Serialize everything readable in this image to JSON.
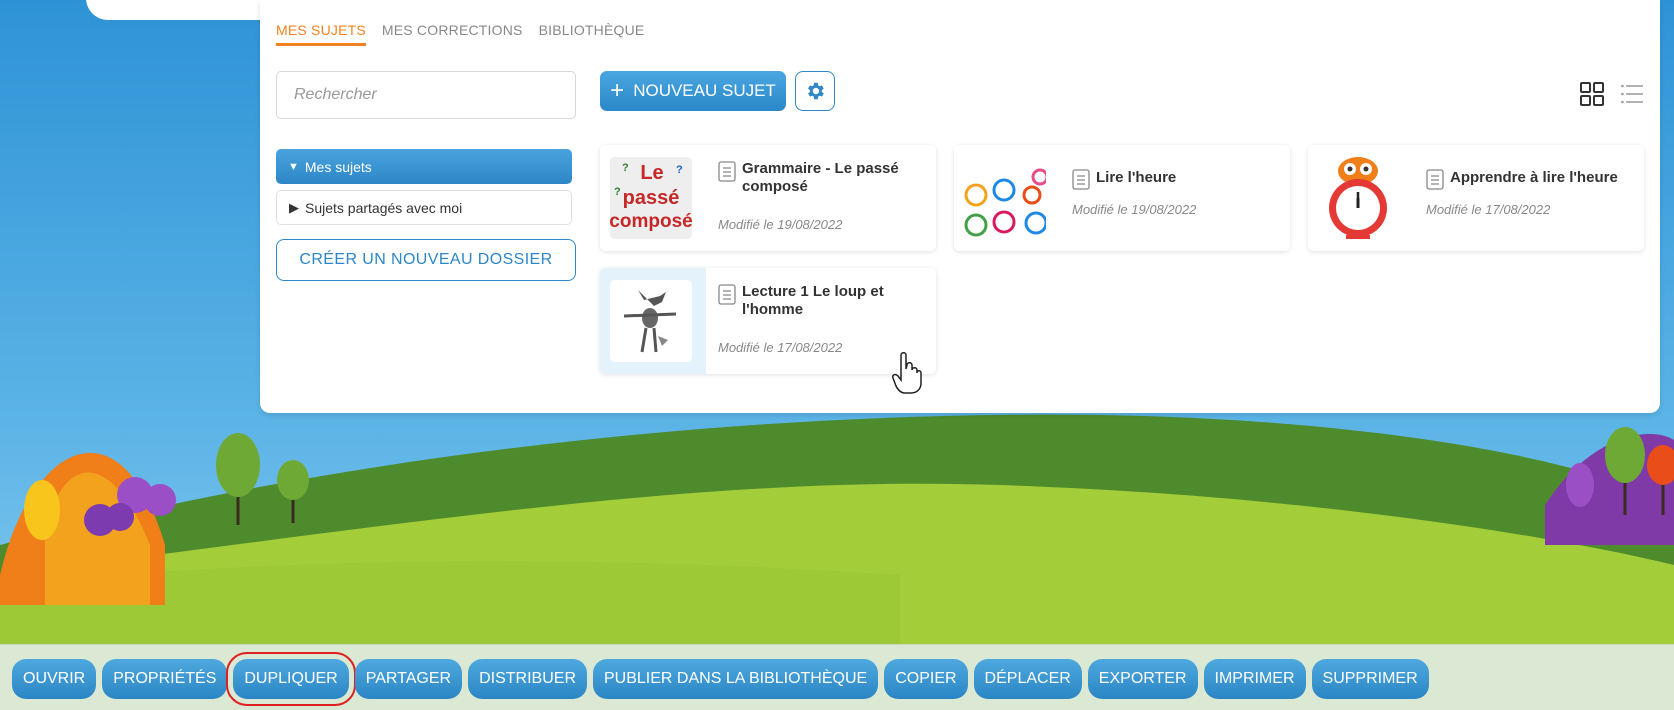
{
  "tabs": [
    {
      "label": "MES SUJETS",
      "active": true
    },
    {
      "label": "MES CORRECTIONS",
      "active": false
    },
    {
      "label": "BIBLIOTHÈQUE",
      "active": false
    }
  ],
  "search": {
    "placeholder": "Rechercher"
  },
  "folders": {
    "mine": "Mes sujets",
    "shared": "Sujets partagés avec moi",
    "create_label": "CRÉER UN NOUVEAU DOSSIER"
  },
  "toolbar": {
    "new_subject_label": "NOUVEAU SUJET",
    "settings_icon": "gear-icon",
    "grid_icon": "grid-view-icon",
    "list_icon": "list-view-icon"
  },
  "cards": [
    {
      "title": "Grammaire - Le passé composé",
      "date": "Modifié le 19/08/2022",
      "thumb": "passe-compose-image"
    },
    {
      "title": "Lire l'heure",
      "date": "Modifié le 19/08/2022",
      "thumb": "clocks-image"
    },
    {
      "title": "Apprendre à lire l'heure",
      "date": "Modifié le 17/08/2022",
      "thumb": "owl-clock-image"
    },
    {
      "title": "Lecture 1 Le loup et l'homme",
      "date": "Modifié le 17/08/2022",
      "thumb": "wolf-image"
    }
  ],
  "thumb_text": {
    "le": "Le",
    "passe": "passé",
    "compose": "composé"
  },
  "actions": [
    "OUVRIR",
    "PROPRIÉTÉS",
    "DUPLIQUER",
    "PARTAGER",
    "DISTRIBUER",
    "PUBLIER DANS LA BIBLIOTHÈQUE",
    "COPIER",
    "DÉPLACER",
    "EXPORTER",
    "IMPRIMER",
    "SUPPRIMER"
  ],
  "highlighted_action": "DUPLIQUER",
  "colors": {
    "accent": "#f58220",
    "primary": "#2d87c8",
    "highlight": "#e02020"
  }
}
